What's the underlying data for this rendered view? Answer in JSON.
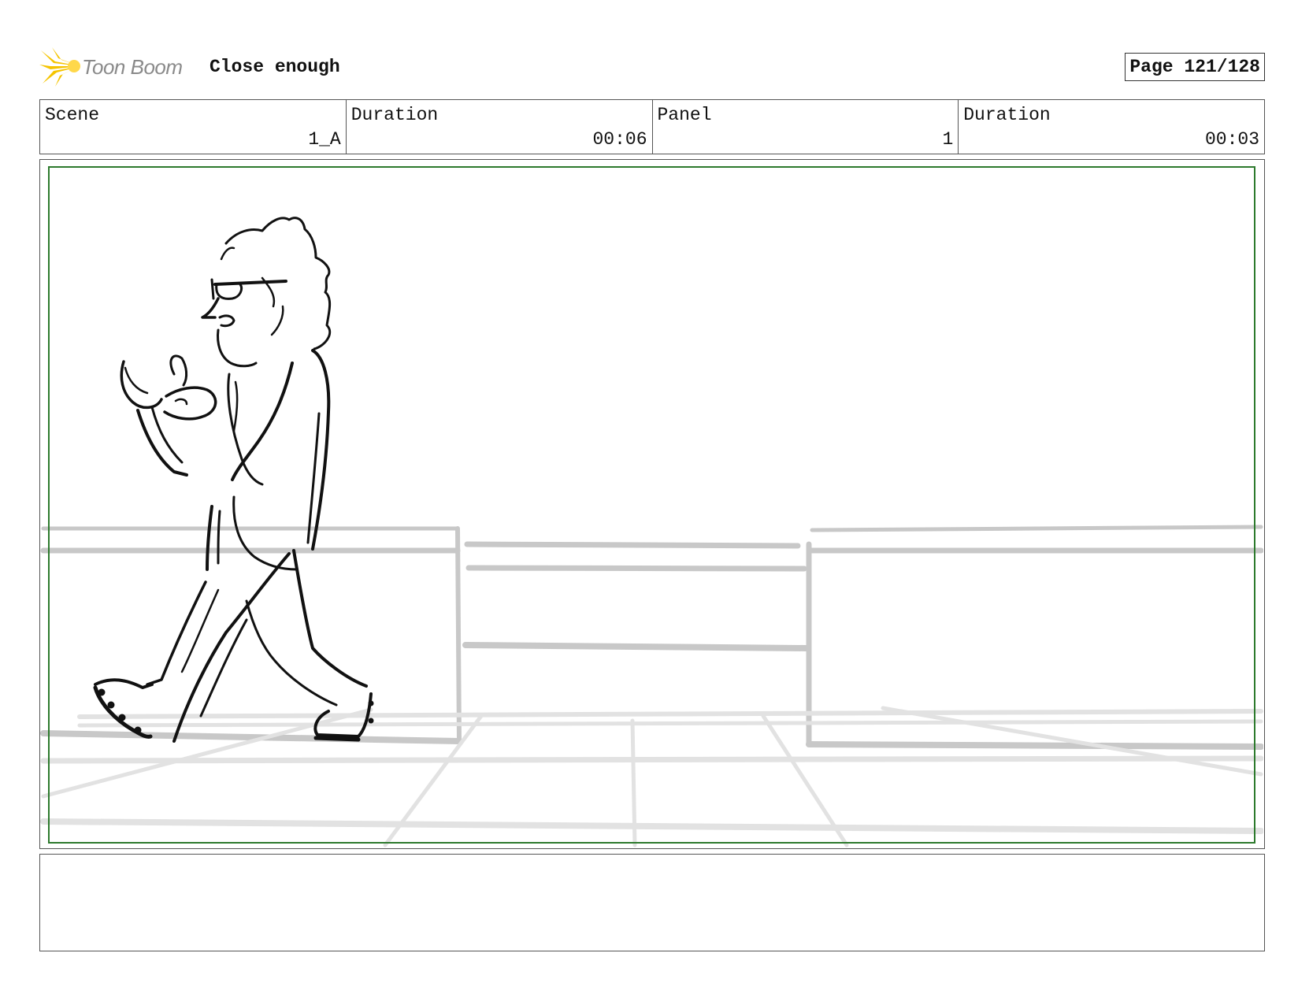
{
  "header": {
    "logo_text": "Toon Boom",
    "project_title": "Close enough",
    "page_label": "Page 121/128"
  },
  "info": {
    "scene_label": "Scene",
    "scene_value": "1_A",
    "scene_duration_label": "Duration",
    "scene_duration_value": "00:06",
    "panel_label": "Panel",
    "panel_value": "1",
    "panel_duration_label": "Duration",
    "panel_duration_value": "00:03"
  },
  "colors": {
    "safe_frame": "#2d7a2d",
    "logo_flare": "#f5c400",
    "background_lines": "#c8c8c8"
  },
  "notes": {
    "text": ""
  }
}
